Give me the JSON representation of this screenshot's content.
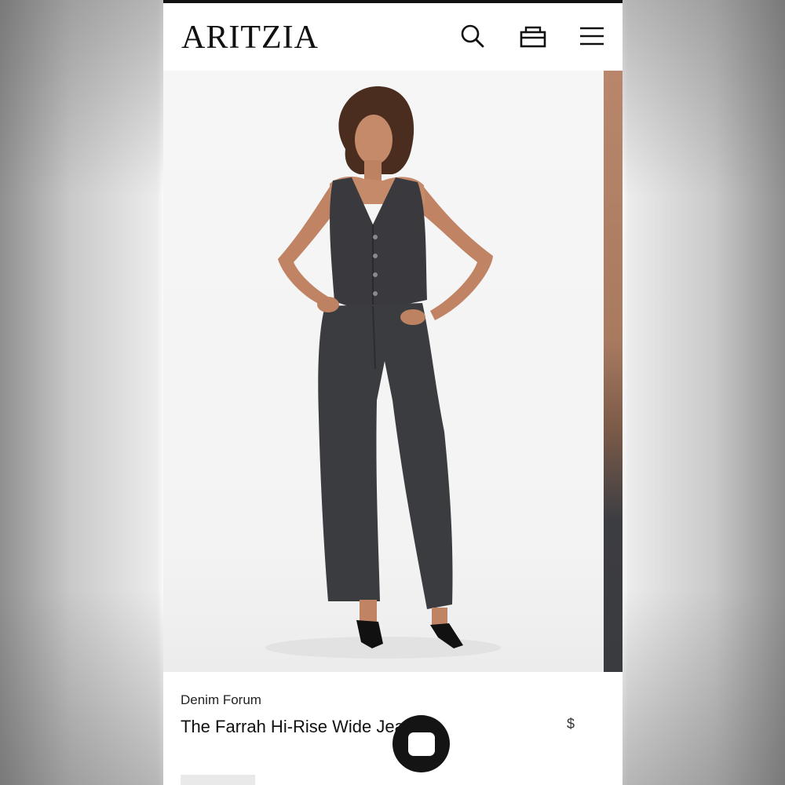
{
  "header": {
    "logo_text": "ARITZIA",
    "icons": [
      "search-icon",
      "bag-icon",
      "menu-icon"
    ]
  },
  "product": {
    "brand": "Denim Forum",
    "name": "The Farrah Hi-Rise Wide Jean",
    "price": "$",
    "tag": ""
  },
  "chat": {
    "icon": "chat-icon",
    "accent": "#141414"
  }
}
